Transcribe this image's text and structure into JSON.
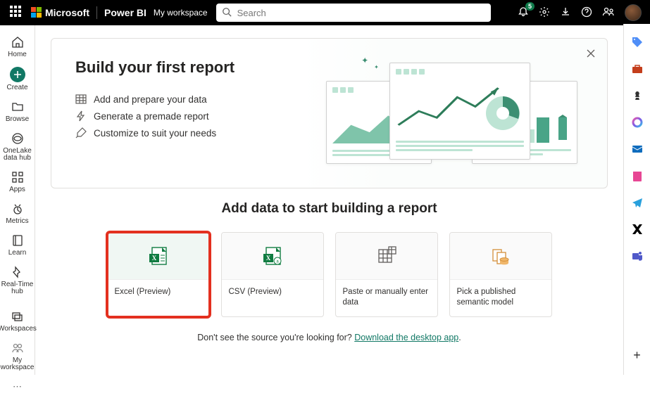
{
  "header": {
    "company": "Microsoft",
    "product": "Power BI",
    "workspace": "My workspace",
    "search_placeholder": "Search",
    "notification_count": "5"
  },
  "leftnav": {
    "home": "Home",
    "create": "Create",
    "browse": "Browse",
    "onelake": "OneLake data hub",
    "apps": "Apps",
    "metrics": "Metrics",
    "learn": "Learn",
    "realtime": "Real-Time hub",
    "workspaces": "Workspaces",
    "myworkspace": "My workspace"
  },
  "hero": {
    "title": "Build your first report",
    "step1": "Add and prepare your data",
    "step2": "Generate a premade report",
    "step3": "Customize to suit your needs"
  },
  "section_title": "Add data to start building a report",
  "cards": {
    "excel": "Excel (Preview)",
    "csv": "CSV (Preview)",
    "paste": "Paste or manually enter data",
    "semantic": "Pick a published semantic model"
  },
  "footer": {
    "text": "Don't see the source you're looking for? ",
    "link": "Download the desktop app",
    "suffix": "."
  }
}
